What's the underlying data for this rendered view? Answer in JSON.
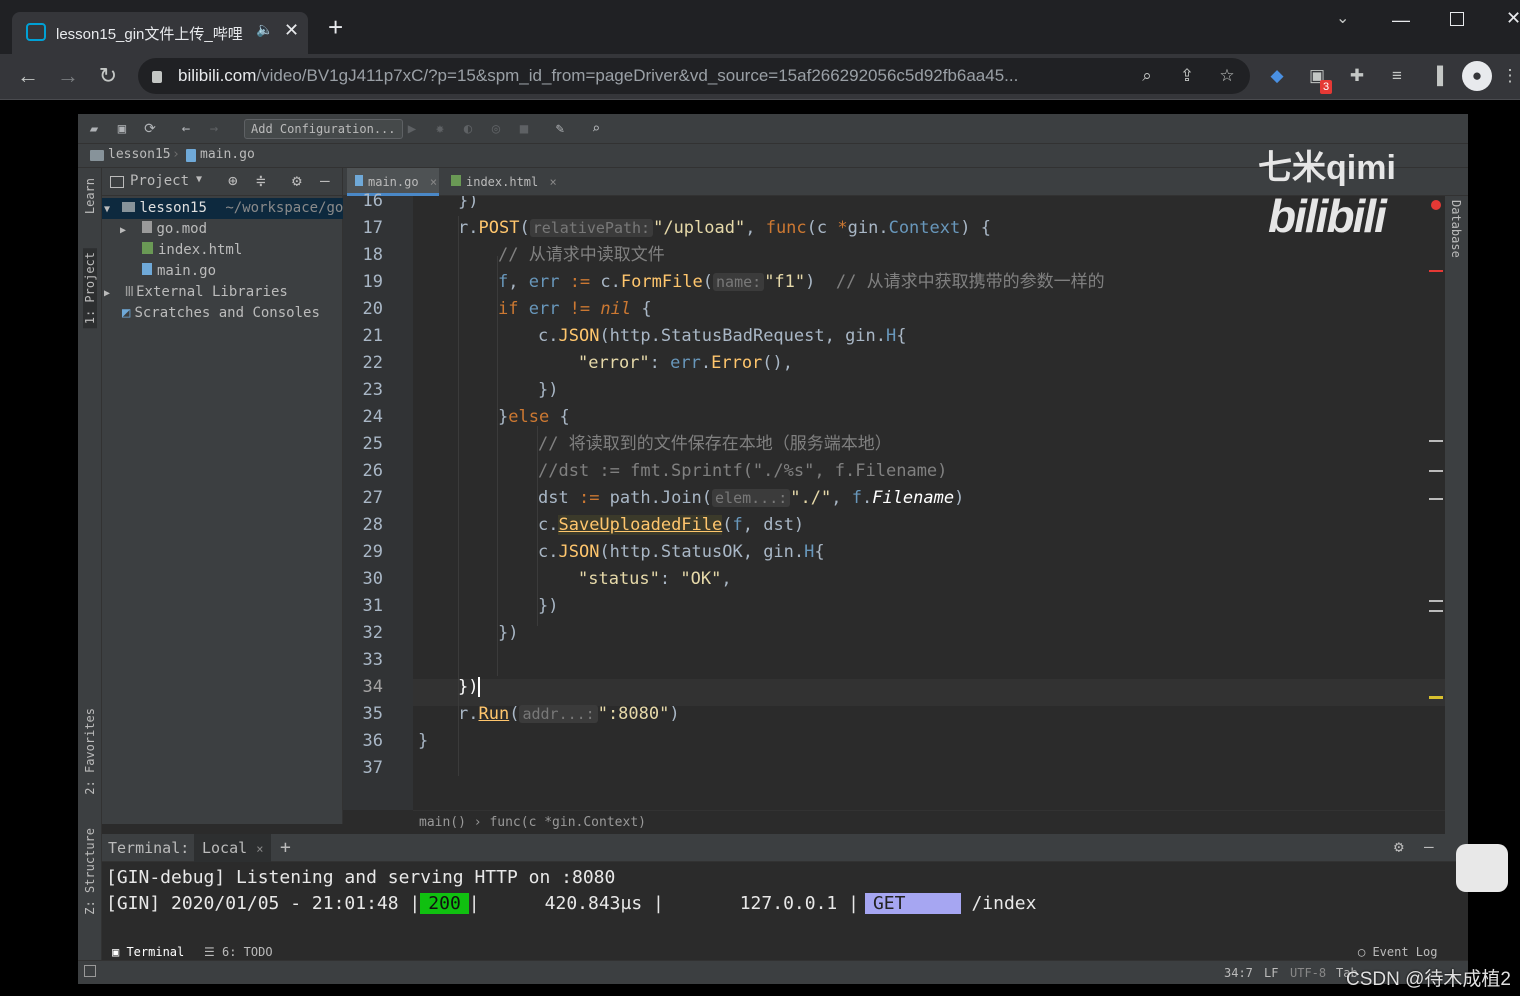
{
  "browser": {
    "tab_title": "lesson15_gin文件上传_哔哩",
    "url_domain": "bilibili.com",
    "url_path": "/video/BV1gJ411p7xC/?p=15&spm_id_from=pageDriver&vd_source=15af266292056c5d92fb6aa45...",
    "ext_badge": "3",
    "new_tab": "+"
  },
  "ide": {
    "run_config": "Add Configuration...",
    "breadcrumb": {
      "project": "lesson15",
      "file": "main.go"
    },
    "left_tabs": {
      "learn": "Learn",
      "project": "1: Project",
      "favorites": "2: Favorites",
      "structure": "Z: Structure"
    },
    "project_pane": {
      "title": "Project",
      "root": "lesson15",
      "root_path": "~/workspace/go",
      "items": [
        "go.mod",
        "index.html",
        "main.go"
      ],
      "external": "External Libraries",
      "scratches": "Scratches and Consoles"
    },
    "file_tabs": [
      "main.go",
      "index.html"
    ],
    "right_tab": "Database",
    "line_numbers": [
      "16",
      "17",
      "18",
      "19",
      "20",
      "21",
      "22",
      "23",
      "24",
      "25",
      "26",
      "27",
      "28",
      "29",
      "30",
      "31",
      "32",
      "33",
      "34",
      "35",
      "36",
      "37"
    ],
    "hints": {
      "relativePath": "relativePath:",
      "name": "name:",
      "elem": "elem...:",
      "addr": "addr...:"
    },
    "code_breadcrumb": "main()  ›  func(c *gin.Context)",
    "terminal": {
      "label": "Terminal:",
      "tab": "Local",
      "line1": "[GIN-debug] Listening and serving HTTP on :8080",
      "line2_prefix": "[GIN] 2020/01/05 - 21:01:48 |",
      "status": "200",
      "line2_mid": "|      420.843µs |       127.0.0.1 |",
      "method": "GET",
      "path": "/index"
    },
    "bottom_tabs": {
      "terminal": "Terminal",
      "todo": "6: TODO",
      "event_log": "Event Log"
    },
    "status": {
      "pos": "34:7",
      "lf": "LF",
      "enc": "UTF-8",
      "tab": "Tab"
    }
  },
  "overlay": {
    "watermark": "七米qimi",
    "csdn": "CSDN @待木成植2"
  }
}
